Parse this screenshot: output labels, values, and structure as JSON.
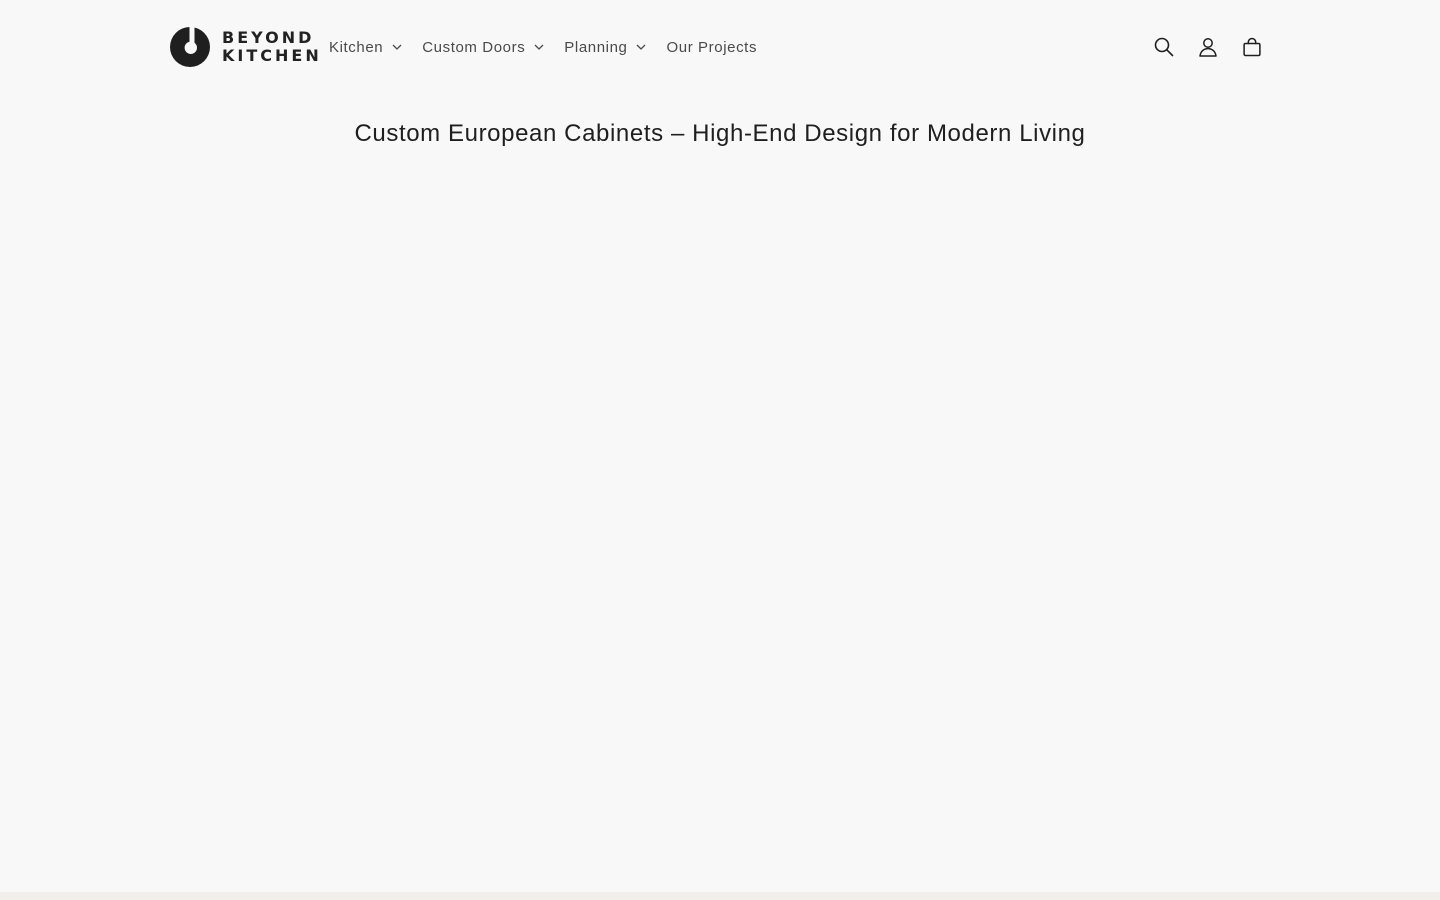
{
  "brand": {
    "line1": "BEYOND",
    "line2": "KITCHEN",
    "logo_icon": "brand-logo-icon"
  },
  "nav": {
    "items": [
      {
        "label": "Kitchen",
        "has_dropdown": true
      },
      {
        "label": "Custom Doors",
        "has_dropdown": true
      },
      {
        "label": "Planning",
        "has_dropdown": true
      },
      {
        "label": "Our Projects",
        "has_dropdown": false
      }
    ]
  },
  "header_icons": {
    "search": "search-icon",
    "account": "account-icon",
    "cart": "cart-icon"
  },
  "main": {
    "title": "Custom European Cabinets – High-End Design for Modern Living"
  },
  "colors": {
    "background": "#f8f8f8",
    "text": "#1f1f1f",
    "nav_text": "#4a4a4a",
    "footer_strip": "#f2efea"
  }
}
